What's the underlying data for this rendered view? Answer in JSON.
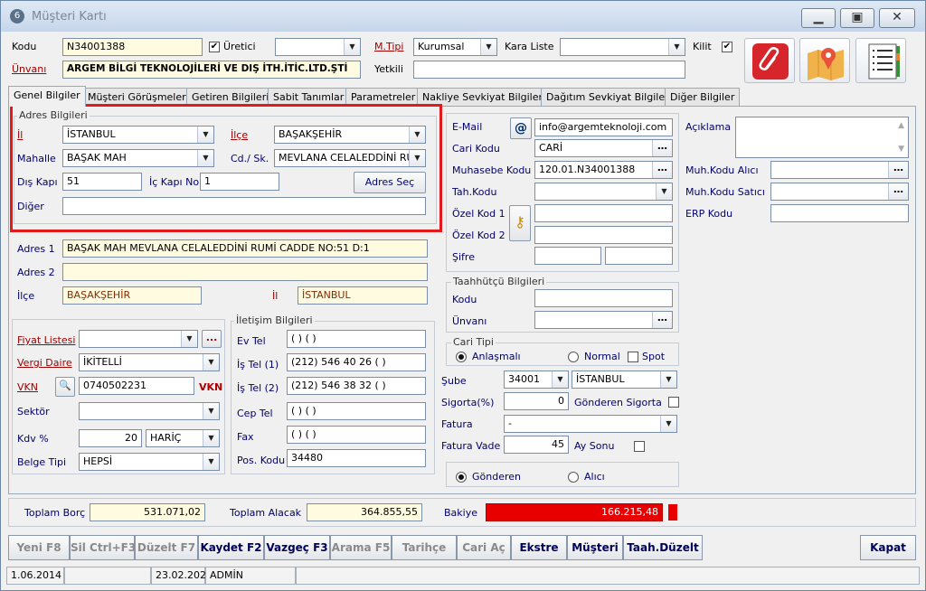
{
  "window": {
    "title": "Müşteri Kartı",
    "app_icon": "6",
    "min_icon": "minimize-icon",
    "max_icon": "maximize-icon",
    "close_icon": "close-icon"
  },
  "header": {
    "kodu_label": "Kodu",
    "kodu_value": "N34001388",
    "uretici_label": "Üretici",
    "uretici_checked": "✔",
    "mtipi_label": "M.Tipi",
    "mtipi_value": "Kurumsal",
    "kara_liste_label": "Kara Liste",
    "kilit_label": "Kilit",
    "kilit_checked": "✔",
    "unvani_label": "Ünvanı",
    "unvani_value": "ARGEM BİLGİ TEKNOLOJİLERİ VE DIŞ İTH.İTİC.LTD.ŞTİ",
    "yetkili_label": "Yetkili"
  },
  "tabs": [
    "Genel Bilgiler",
    "Müşteri Görüşmeleri",
    "Getiren Bilgileri",
    "Sabit Tanımlar",
    "Parametreler",
    "Nakliye Sevkiyat Bilgileri",
    "Dağıtım Sevkiyat Bilgileri",
    "Diğer Bilgiler"
  ],
  "adres_bilgileri": {
    "title": "Adres Bilgileri",
    "il_label": "İl",
    "il_value": "İSTANBUL",
    "ilce_label": "İlçe",
    "ilce_value": "BAŞAKŞEHİR",
    "mahalle_label": "Mahalle",
    "mahalle_value": "BAŞAK MAH",
    "cd_label": "Cd./ Sk.",
    "cd_value": "MEVLANA CELALEDDİNİ RU",
    "dis_kapi_label": "Dış Kapı",
    "dis_kapi_value": "51",
    "ic_kapi_label": "İç Kapı No",
    "ic_kapi_value": "1",
    "adres_sec_label": "Adres Seç",
    "diger_label": "Diğer"
  },
  "adres": {
    "adres1_label": "Adres 1",
    "adres1_value": "BAŞAK MAH MEVLANA CELALEDDİNİ RUMİ CADDE NO:51 D:1",
    "adres2_label": "Adres 2",
    "ilce_label": "İlçe",
    "ilce_value": "BAŞAKŞEHİR",
    "il_label": "İl",
    "il_value": "İSTANBUL"
  },
  "finans": {
    "fiyat_listesi_label": "Fiyat Listesi",
    "fiyat_dots": "...",
    "vergi_daire_label": "Vergi Daire",
    "vergi_daire_value": "İKİTELLİ",
    "vkn_label": "VKN",
    "vkn_value": "0740502231",
    "vkn_tag": "VKN",
    "sektor_label": "Sektör",
    "kdv_label": "Kdv %",
    "kdv_value": "20",
    "kdv_type": "HARİÇ",
    "belge_tipi_label": "Belge Tipi",
    "belge_tipi_value": "HEPSİ"
  },
  "iletisim": {
    "title": "İletişim Bilgileri",
    "ev_tel_label": "Ev Tel",
    "ev_tel_value": "(  )           (  )",
    "is_tel1_label": "İş Tel (1)",
    "is_tel1_value": "(212) 546 40 26 (  )",
    "is_tel2_label": "İş Tel (2)",
    "is_tel2_value": "(212) 546 38 32 (  )",
    "cep_tel_label": "Cep Tel",
    "cep_tel_value": "(  )           (  )",
    "fax_label": "Fax",
    "fax_value": "(  )           (  )",
    "pos_kodu_label": "Pos. Kodu",
    "pos_kodu_value": "34480"
  },
  "cari": {
    "email_label": "E-Mail",
    "email_value": "info@argemteknoloji.com",
    "cari_kodu_label": "Cari Kodu",
    "cari_kodu_value": "CARİ",
    "muhasebe_kodu_label": "Muhasebe Kodu",
    "muhasebe_kodu_value": "120.01.N34001388",
    "tah_kodu_label": "Tah.Kodu",
    "ozel_kod1_label": "Özel Kod 1",
    "ozel_kod2_label": "Özel Kod 2",
    "sifre_label": "Şifre"
  },
  "sag": {
    "aciklama_label": "Açıklama",
    "muh_alici_label": "Muh.Kodu Alıcı",
    "muh_satici_label": "Muh.Kodu Satıcı",
    "erp_kodu_label": "ERP Kodu"
  },
  "taahhutcu": {
    "title": "Taahhütçü Bilgileri",
    "kodu_label": "Kodu",
    "unvani_label": "Ünvanı"
  },
  "cari_tipi": {
    "title": "Cari Tipi",
    "anlasmali_label": "Anlaşmalı",
    "normal_label": "Normal",
    "spot_label": "Spot",
    "sube_label": "Şube",
    "sube_code": "34001",
    "sube_name": "İSTANBUL",
    "sigorta_label": "Sigorta(%)",
    "sigorta_value": "0",
    "gonderen_sigorta_label": "Gönderen Sigorta",
    "fatura_label": "Fatura",
    "fatura_value": "-",
    "fatura_vade_label": "Fatura Vade",
    "fatura_vade_value": "45",
    "ay_sonu_label": "Ay Sonu"
  },
  "odeme": {
    "gonderen_label": "Gönderen",
    "alici_label": "Alıcı"
  },
  "totals": {
    "borc_label": "Toplam Borç",
    "borc_value": "531.071,02",
    "alacak_label": "Toplam Alacak",
    "alacak_value": "364.855,55",
    "bakiye_label": "Bakiye",
    "bakiye_value": "166.215,48"
  },
  "toolbar": {
    "yeni": "Yeni F8",
    "sil": "Sil Ctrl+F3",
    "duzelt": "Düzelt F7",
    "kaydet": "Kaydet F2",
    "vazgec": "Vazgeç F3",
    "arama": "Arama F5",
    "tarihce": "Tarihçe",
    "cari_ac": "Cari Aç",
    "ekstre": "Ekstre",
    "musteri": "Müşteri",
    "taah_duzelt": "Taah.Düzelt",
    "kapat": "Kapat"
  },
  "status": {
    "date1": "1.06.2014",
    "date2": "23.02.202",
    "user": "ADMİN"
  },
  "colors": {
    "accent_red": "#e3191c",
    "bakiye_bg": "#e80000",
    "link": "#a00000"
  }
}
